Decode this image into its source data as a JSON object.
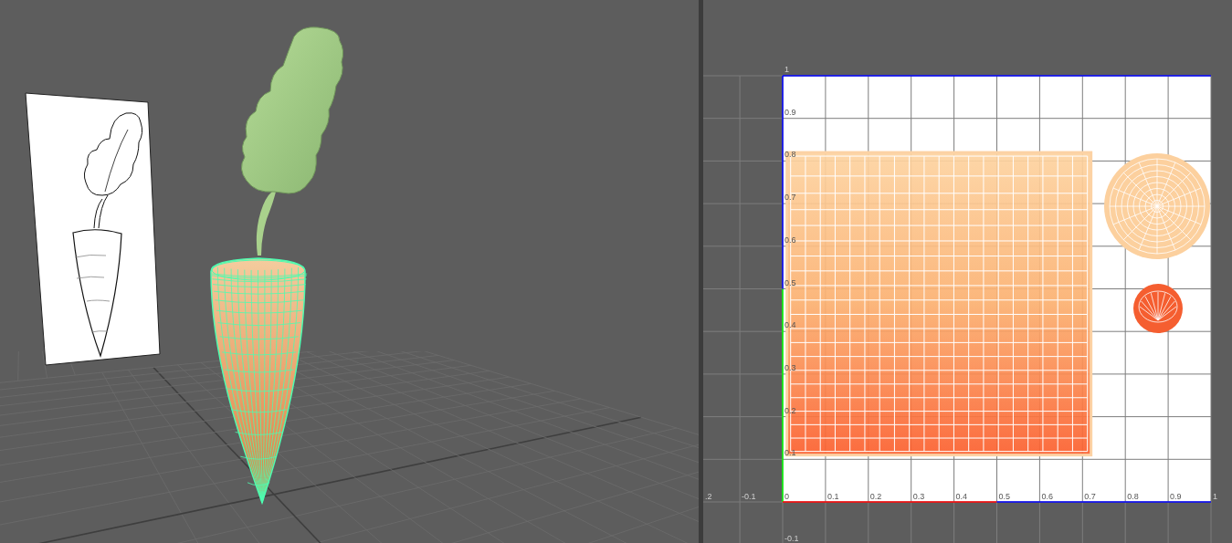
{
  "viewport": {
    "carrot_selected": true
  },
  "uv_editor": {
    "v_labels": [
      "1",
      "0.9",
      "0.8",
      "0.7",
      "0.6",
      "0.5",
      "0.4",
      "0.3",
      "0.2",
      "0.1"
    ],
    "u_labels": [
      ".2",
      "-0.1",
      "0",
      "0.1",
      "0.2",
      "0.3",
      "0.4",
      "0.5",
      "0.6",
      "0.7",
      "0.8",
      "0.9",
      "1"
    ],
    "bottom_label": "-0.1"
  }
}
